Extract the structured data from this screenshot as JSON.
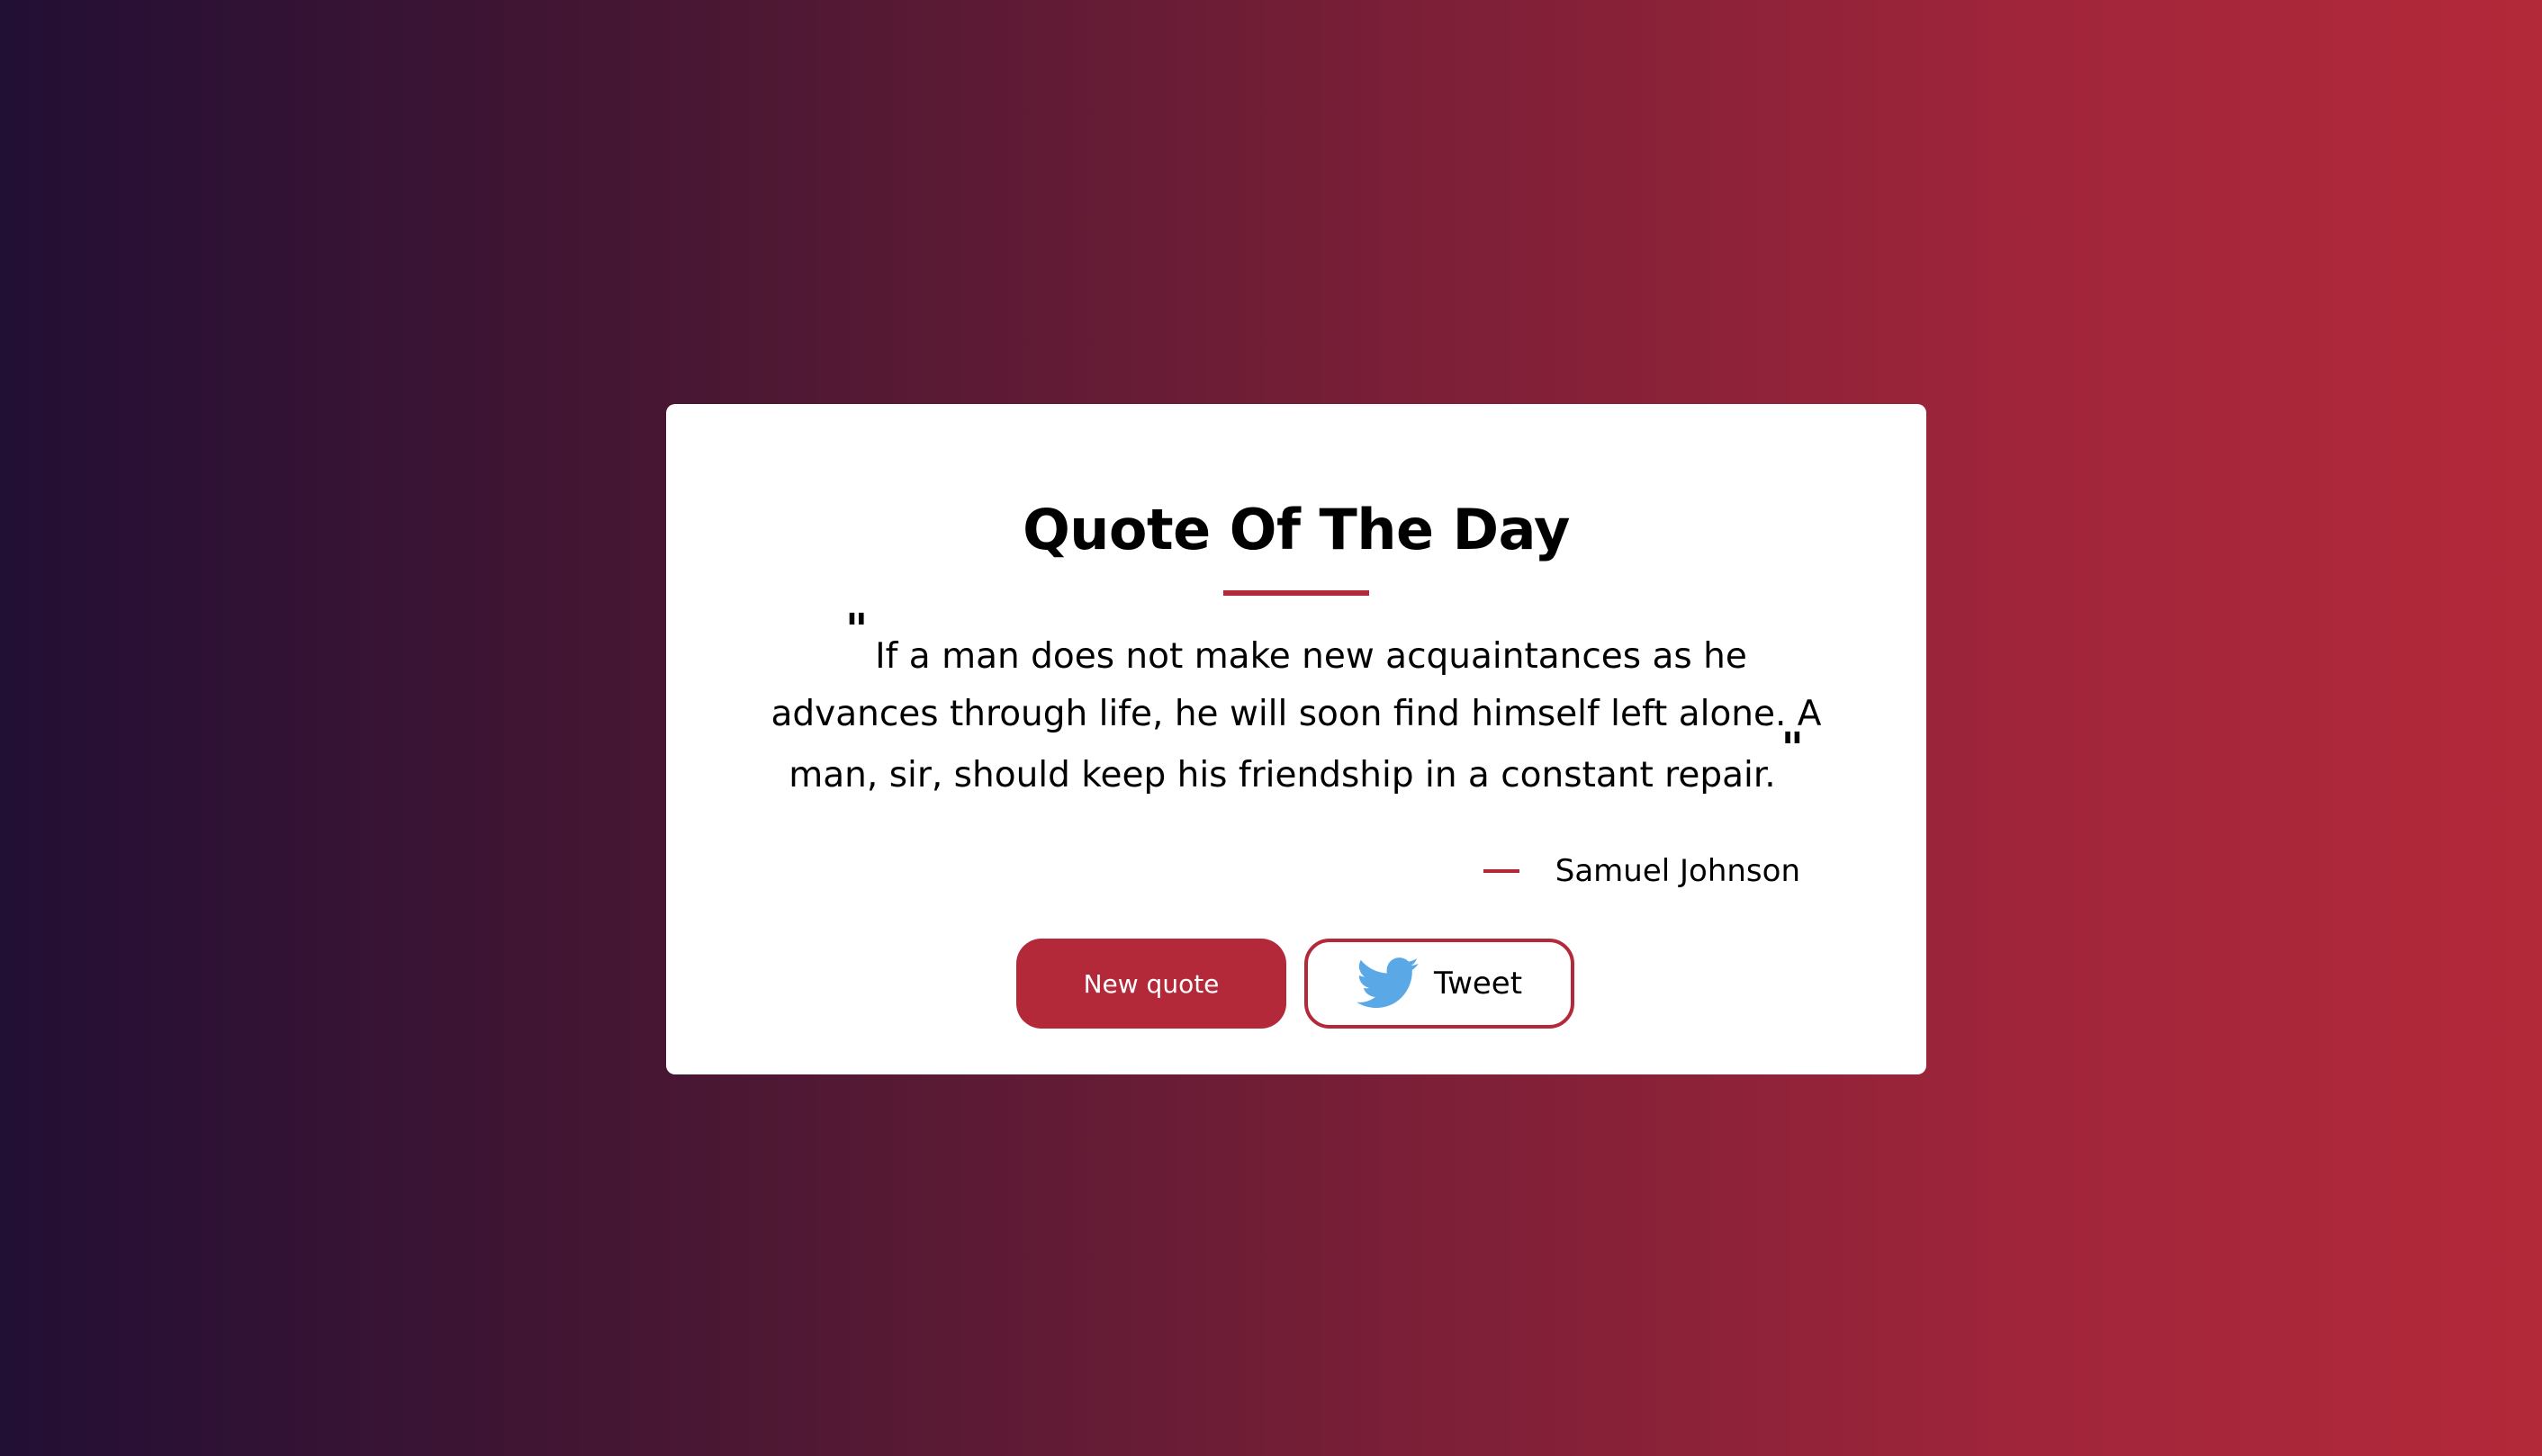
{
  "card": {
    "title": "Quote Of The Day",
    "quote": {
      "open_mark": "\"",
      "text": "If a man does not make new acquaintances as he advances through life, he will soon find himself left alone. A man, sir, should keep his friendship in a constant repair.",
      "close_mark": "\""
    },
    "author": "Samuel Johnson",
    "buttons": {
      "new_quote": "New quote",
      "tweet": "Tweet"
    }
  },
  "icons": {
    "tweet_icon": "twitter-bird-icon"
  },
  "colors": {
    "accent": "#b3293a",
    "twitter_blue": "#5aa9e6",
    "background_start": "#220f34",
    "background_end": "#b3293a",
    "card": "#ffffff"
  }
}
